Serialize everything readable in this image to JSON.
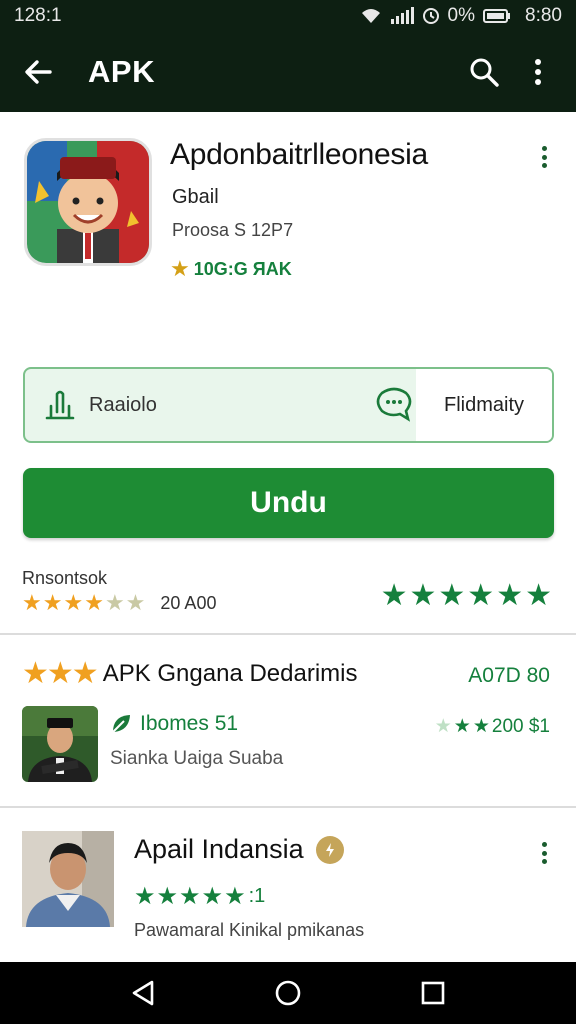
{
  "status_bar": {
    "time": "128:1",
    "battery_text": "0%",
    "clock": "8:80"
  },
  "app_bar": {
    "title": "APK",
    "back_icon": "arrow-left-icon",
    "search_icon": "search-icon",
    "menu_icon": "more-vert-icon"
  },
  "app": {
    "name": "Apdonbaitrlleonesia",
    "subtitle": "Gbail",
    "meta": "Proosa S 12P7",
    "rating_text": "10G:G ЯAK"
  },
  "segments": {
    "left_label": "Raaiolo",
    "right_label": "Flidmaity"
  },
  "install_button": {
    "label": "Undu"
  },
  "ratings": {
    "label": "Rnsontsok",
    "count": "20 A00",
    "small_stars": 4,
    "big_stars": 6
  },
  "list": {
    "item1": {
      "title": "APK Gngana Dedarimis",
      "price": "A07D 80",
      "green_label": "Ibomes 51",
      "grey_label": "Sianka Uaiga Suaba",
      "right_rating": "200 $1"
    },
    "item2": {
      "title": "Apail Indansia",
      "rating_suffix": ":1",
      "desc": "Pawamaral Kinikal pmikanas"
    }
  },
  "colors": {
    "bar_dark": "#0d1f12",
    "primary_green": "#1e8c34",
    "accent_green": "#15803d",
    "gold": "#f0a020"
  }
}
